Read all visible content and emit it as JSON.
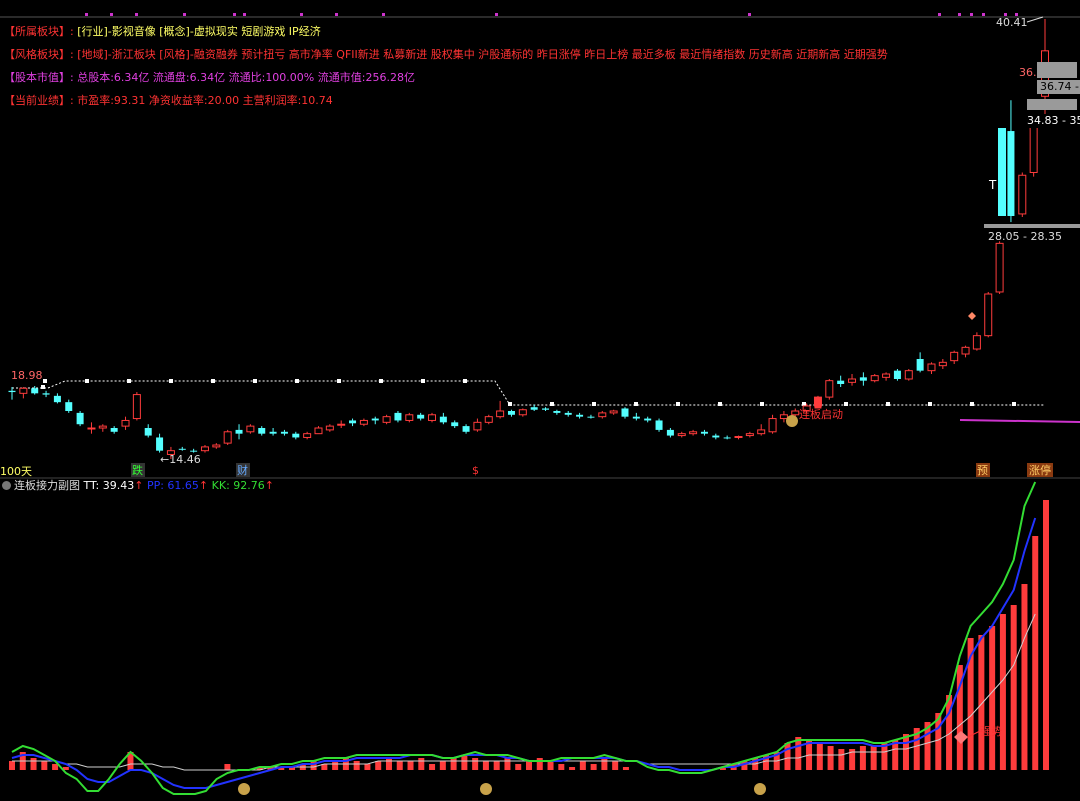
{
  "info_lines": [
    {
      "key": "【所属板块】:",
      "value": "[行业]-影视音像 [概念]-虚拟现实 短剧游戏 IP经济",
      "key_color": "#ff3333",
      "value_color": "#ffff66"
    },
    {
      "key": "【风格板块】:",
      "value": "[地域]-浙江板块 [风格]-融资融券 预计扭亏 高市净率 QFII新进 私募新进 股权集中 沪股通标的 昨日涨停 昨日上榜 最近多板 最近情绪指数 历史新高 近期新高 近期强势",
      "key_color": "#ff3333",
      "value_color": "#ff3333"
    },
    {
      "key": "【股本市值】:",
      "value": "总股本:6.34亿 流通盘:6.34亿 流通比:100.00% 流通市值:256.28亿",
      "key_color": "#e040e0",
      "value_color": "#e040e0"
    },
    {
      "key": "【当前业绩】:",
      "value": "市盈率:93.31 净资收益率:20.00 主营利润率:10.74",
      "key_color": "#ff3333",
      "value_color": "#ff3333"
    }
  ],
  "price_labels": {
    "low_left": "18.98",
    "low_mid": "←14.46",
    "high_right": "40.41",
    "level_36": "36.",
    "zone_1": "36.74 - 3",
    "zone_2": "34.83 - 35",
    "zone_3": "28.05 - 28.35",
    "t_marker": "T"
  },
  "markers": {
    "days100": "100天",
    "die": "跌",
    "cai": "财",
    "dollar": "$",
    "yu": "预",
    "zhangting": "涨停",
    "lianban": "连板启动",
    "qiangshi": "强势"
  },
  "sub_panel": {
    "name": "连板接力副图",
    "tt_label": "TT: 39.43",
    "pp_label": "PP: 61.65",
    "kk_label": "KK: 92.76",
    "arrow": "↑"
  },
  "colors": {
    "up": "#ff3c3c",
    "down": "#54ffff",
    "kk_line": "#33dd33",
    "pp_line": "#2233ff",
    "tt_line": "#d0d0d0",
    "ma_dotted": "#ffffff",
    "magenta": "#cc33cc"
  },
  "chart_data": {
    "type": "candlestick",
    "y_axis": "price",
    "candles": [
      {
        "o": 18.6,
        "h": 18.9,
        "l": 17.9,
        "c": 18.5
      },
      {
        "o": 18.4,
        "h": 18.9,
        "l": 18.0,
        "c": 18.8
      },
      {
        "o": 18.8,
        "h": 18.98,
        "l": 18.3,
        "c": 18.4
      },
      {
        "o": 18.4,
        "h": 18.6,
        "l": 18.1,
        "c": 18.3
      },
      {
        "o": 18.2,
        "h": 18.4,
        "l": 17.6,
        "c": 17.7
      },
      {
        "o": 17.7,
        "h": 17.9,
        "l": 16.9,
        "c": 17.0
      },
      {
        "o": 16.9,
        "h": 17.0,
        "l": 16.2,
        "c": 16.3
      },
      {
        "o": 16.1,
        "h": 16.4,
        "l": 15.8,
        "c": 16.1
      },
      {
        "o": 16.1,
        "h": 16.3,
        "l": 15.9,
        "c": 16.2
      },
      {
        "o": 16.1,
        "h": 16.2,
        "l": 15.8,
        "c": 15.9
      },
      {
        "o": 16.2,
        "h": 16.7,
        "l": 16.0,
        "c": 16.5
      },
      {
        "o": 16.6,
        "h": 18.5,
        "l": 16.5,
        "c": 18.3
      },
      {
        "o": 16.1,
        "h": 16.3,
        "l": 15.6,
        "c": 15.7
      },
      {
        "o": 15.6,
        "h": 15.8,
        "l": 14.8,
        "c": 14.9
      },
      {
        "o": 14.7,
        "h": 15.1,
        "l": 14.46,
        "c": 14.9
      },
      {
        "o": 15.0,
        "h": 15.1,
        "l": 14.9,
        "c": 14.95
      },
      {
        "o": 14.9,
        "h": 15.0,
        "l": 14.8,
        "c": 14.85
      },
      {
        "o": 14.9,
        "h": 15.2,
        "l": 14.8,
        "c": 15.1
      },
      {
        "o": 15.1,
        "h": 15.3,
        "l": 15.0,
        "c": 15.2
      },
      {
        "o": 15.3,
        "h": 16.0,
        "l": 15.2,
        "c": 15.9
      },
      {
        "o": 16.0,
        "h": 16.3,
        "l": 15.5,
        "c": 15.8
      },
      {
        "o": 15.9,
        "h": 16.3,
        "l": 15.8,
        "c": 16.2
      },
      {
        "o": 16.1,
        "h": 16.2,
        "l": 15.7,
        "c": 15.8
      },
      {
        "o": 15.9,
        "h": 16.1,
        "l": 15.7,
        "c": 15.8
      },
      {
        "o": 15.9,
        "h": 16.0,
        "l": 15.7,
        "c": 15.8
      },
      {
        "o": 15.8,
        "h": 15.9,
        "l": 15.5,
        "c": 15.6
      },
      {
        "o": 15.6,
        "h": 15.9,
        "l": 15.5,
        "c": 15.8
      },
      {
        "o": 15.8,
        "h": 16.2,
        "l": 15.8,
        "c": 16.1
      },
      {
        "o": 16.0,
        "h": 16.3,
        "l": 15.9,
        "c": 16.2
      },
      {
        "o": 16.3,
        "h": 16.5,
        "l": 16.1,
        "c": 16.3
      },
      {
        "o": 16.5,
        "h": 16.6,
        "l": 16.2,
        "c": 16.35
      },
      {
        "o": 16.3,
        "h": 16.6,
        "l": 16.2,
        "c": 16.5
      },
      {
        "o": 16.6,
        "h": 16.7,
        "l": 16.3,
        "c": 16.5
      },
      {
        "o": 16.4,
        "h": 16.8,
        "l": 16.3,
        "c": 16.7
      },
      {
        "o": 16.9,
        "h": 17.0,
        "l": 16.4,
        "c": 16.5
      },
      {
        "o": 16.5,
        "h": 16.9,
        "l": 16.4,
        "c": 16.8
      },
      {
        "o": 16.8,
        "h": 16.9,
        "l": 16.5,
        "c": 16.6
      },
      {
        "o": 16.5,
        "h": 16.9,
        "l": 16.4,
        "c": 16.8
      },
      {
        "o": 16.7,
        "h": 16.9,
        "l": 16.3,
        "c": 16.4
      },
      {
        "o": 16.4,
        "h": 16.5,
        "l": 16.1,
        "c": 16.2
      },
      {
        "o": 16.2,
        "h": 16.3,
        "l": 15.8,
        "c": 15.9
      },
      {
        "o": 16.0,
        "h": 16.6,
        "l": 15.9,
        "c": 16.4
      },
      {
        "o": 16.4,
        "h": 16.8,
        "l": 16.3,
        "c": 16.7
      },
      {
        "o": 16.7,
        "h": 17.8,
        "l": 16.6,
        "c": 17.0
      },
      {
        "o": 17.0,
        "h": 17.1,
        "l": 16.7,
        "c": 16.8
      },
      {
        "o": 16.8,
        "h": 17.2,
        "l": 16.7,
        "c": 17.1
      },
      {
        "o": 17.3,
        "h": 17.5,
        "l": 17.0,
        "c": 17.1
      },
      {
        "o": 17.2,
        "h": 17.3,
        "l": 17.0,
        "c": 17.1
      },
      {
        "o": 17.0,
        "h": 17.1,
        "l": 16.8,
        "c": 16.9
      },
      {
        "o": 16.9,
        "h": 17.0,
        "l": 16.7,
        "c": 16.8
      },
      {
        "o": 16.8,
        "h": 16.9,
        "l": 16.6,
        "c": 16.7
      },
      {
        "o": 16.7,
        "h": 16.8,
        "l": 16.6,
        "c": 16.65
      },
      {
        "o": 16.7,
        "h": 17.0,
        "l": 16.6,
        "c": 16.9
      },
      {
        "o": 16.9,
        "h": 17.1,
        "l": 16.8,
        "c": 17.0
      },
      {
        "o": 17.2,
        "h": 17.3,
        "l": 16.6,
        "c": 16.7
      },
      {
        "o": 16.7,
        "h": 16.9,
        "l": 16.5,
        "c": 16.6
      },
      {
        "o": 16.6,
        "h": 16.7,
        "l": 16.4,
        "c": 16.5
      },
      {
        "o": 16.5,
        "h": 16.6,
        "l": 15.9,
        "c": 16.0
      },
      {
        "o": 16.0,
        "h": 16.1,
        "l": 15.6,
        "c": 15.7
      },
      {
        "o": 15.7,
        "h": 15.9,
        "l": 15.6,
        "c": 15.8
      },
      {
        "o": 15.8,
        "h": 16.0,
        "l": 15.7,
        "c": 15.9
      },
      {
        "o": 15.9,
        "h": 16.0,
        "l": 15.7,
        "c": 15.8
      },
      {
        "o": 15.7,
        "h": 15.8,
        "l": 15.5,
        "c": 15.6
      },
      {
        "o": 15.6,
        "h": 15.7,
        "l": 15.5,
        "c": 15.55
      },
      {
        "o": 15.6,
        "h": 15.7,
        "l": 15.5,
        "c": 15.65
      },
      {
        "o": 15.7,
        "h": 15.9,
        "l": 15.6,
        "c": 15.8
      },
      {
        "o": 15.8,
        "h": 16.3,
        "l": 15.7,
        "c": 16.0
      },
      {
        "o": 15.9,
        "h": 16.8,
        "l": 15.8,
        "c": 16.6
      },
      {
        "o": 16.6,
        "h": 17.0,
        "l": 16.4,
        "c": 16.8
      },
      {
        "o": 16.8,
        "h": 17.2,
        "l": 16.7,
        "c": 17.0
      },
      {
        "o": 17.0,
        "h": 17.6,
        "l": 16.9,
        "c": 17.4
      },
      {
        "o": 17.4,
        "h": 18.2,
        "l": 17.3,
        "c": 18.1
      },
      {
        "o": 18.1,
        "h": 19.4,
        "l": 17.9,
        "c": 19.3
      },
      {
        "o": 19.3,
        "h": 19.6,
        "l": 18.9,
        "c": 19.1
      },
      {
        "o": 19.2,
        "h": 19.7,
        "l": 19.0,
        "c": 19.4
      },
      {
        "o": 19.5,
        "h": 19.8,
        "l": 19.0,
        "c": 19.3
      },
      {
        "o": 19.3,
        "h": 19.7,
        "l": 19.2,
        "c": 19.6
      },
      {
        "o": 19.5,
        "h": 19.8,
        "l": 19.3,
        "c": 19.7
      },
      {
        "o": 19.9,
        "h": 20.0,
        "l": 19.3,
        "c": 19.4
      },
      {
        "o": 19.4,
        "h": 20.0,
        "l": 19.3,
        "c": 19.9
      },
      {
        "o": 20.6,
        "h": 21.0,
        "l": 19.8,
        "c": 19.9
      },
      {
        "o": 19.9,
        "h": 20.4,
        "l": 19.7,
        "c": 20.3
      },
      {
        "o": 20.2,
        "h": 20.6,
        "l": 20.0,
        "c": 20.4
      },
      {
        "o": 20.5,
        "h": 21.1,
        "l": 20.3,
        "c": 21.0
      },
      {
        "o": 20.9,
        "h": 21.4,
        "l": 20.7,
        "c": 21.3
      },
      {
        "o": 21.2,
        "h": 22.2,
        "l": 21.1,
        "c": 22.0
      },
      {
        "o": 22.0,
        "h": 24.6,
        "l": 21.9,
        "c": 24.5
      },
      {
        "o": 24.6,
        "h": 27.1,
        "l": 24.5,
        "c": 27.0
      },
      {
        "o": 34.5,
        "h": 36.3,
        "l": 28.05,
        "c": 28.35
      },
      {
        "o": 28.5,
        "h": 31.5,
        "l": 28.3,
        "c": 31.3
      },
      {
        "o": 31.5,
        "h": 35.5,
        "l": 31.2,
        "c": 35.3
      },
      {
        "o": 36.5,
        "h": 40.41,
        "l": 35.0,
        "c": 38.8
      }
    ],
    "ma_dotted_levels": [
      18.9,
      19.2,
      17.0,
      17.0
    ],
    "sub_series": {
      "bars": [
        3,
        6,
        4,
        3,
        2,
        1,
        0,
        0,
        0,
        0,
        0,
        6,
        0,
        0,
        0,
        0,
        0,
        0,
        0,
        0,
        2,
        0,
        0,
        1,
        1,
        1,
        1,
        2,
        3,
        2,
        3,
        4,
        3,
        2,
        3,
        4,
        3,
        3,
        4,
        2,
        3,
        4,
        5,
        4,
        3,
        3,
        4,
        2,
        3,
        4,
        3,
        2,
        1,
        3,
        2,
        4,
        3,
        1,
        0,
        0,
        0,
        0,
        0,
        0,
        0,
        0,
        1,
        2,
        3,
        4,
        5,
        6,
        9,
        11,
        10,
        9,
        8,
        7,
        7,
        8,
        8,
        9,
        10,
        12,
        14,
        16,
        19,
        25,
        35,
        44,
        45,
        48,
        52,
        55,
        62,
        78,
        90
      ],
      "kk": [
        6,
        8,
        7,
        5,
        3,
        -1,
        -3,
        -7,
        -7,
        -3,
        2,
        6,
        3,
        -1,
        -6,
        -8,
        -8,
        -8,
        -7,
        -3,
        -1,
        0,
        0,
        1,
        1,
        2,
        2,
        3,
        3,
        4,
        4,
        4,
        5,
        5,
        5,
        5,
        5,
        5,
        5,
        5,
        4,
        4,
        5,
        6,
        5,
        5,
        5,
        4,
        3,
        3,
        3,
        4,
        4,
        4,
        4,
        5,
        4,
        3,
        3,
        1,
        0,
        0,
        -1,
        -1,
        -1,
        0,
        1,
        2,
        3,
        4,
        5,
        6,
        9,
        10,
        10,
        10,
        10,
        10,
        10,
        10,
        9,
        9,
        10,
        11,
        12,
        14,
        17,
        24,
        38,
        48,
        52,
        56,
        62,
        70,
        88,
        96
      ],
      "pp": [
        4,
        5,
        5,
        4,
        3,
        2,
        0,
        -3,
        -4,
        -4,
        -2,
        0,
        0,
        -1,
        -3,
        -5,
        -6,
        -6,
        -6,
        -5,
        -4,
        -3,
        -2,
        -1,
        0,
        1,
        1,
        2,
        2,
        3,
        3,
        3,
        4,
        4,
        4,
        4,
        4,
        5,
        5,
        5,
        4,
        4,
        5,
        5,
        5,
        5,
        4,
        4,
        3,
        3,
        3,
        3,
        4,
        4,
        4,
        4,
        4,
        3,
        3,
        2,
        1,
        1,
        0,
        0,
        0,
        0,
        1,
        1,
        2,
        3,
        4,
        5,
        7,
        8,
        9,
        9,
        9,
        9,
        9,
        9,
        8,
        8,
        9,
        9,
        10,
        12,
        14,
        19,
        28,
        38,
        44,
        48,
        54,
        60,
        73,
        84
      ],
      "tt": [
        3,
        3,
        3,
        3,
        3,
        2,
        2,
        1,
        1,
        1,
        1,
        2,
        2,
        2,
        1,
        1,
        0,
        0,
        0,
        0,
        0,
        0,
        0,
        0,
        1,
        1,
        1,
        1,
        1,
        2,
        2,
        2,
        2,
        2,
        3,
        3,
        3,
        3,
        3,
        3,
        3,
        3,
        3,
        3,
        3,
        3,
        3,
        3,
        3,
        3,
        3,
        3,
        3,
        3,
        3,
        3,
        3,
        3,
        3,
        2,
        2,
        2,
        2,
        2,
        2,
        2,
        2,
        2,
        2,
        2,
        3,
        3,
        4,
        4,
        5,
        5,
        5,
        5,
        6,
        6,
        6,
        6,
        7,
        7,
        8,
        9,
        10,
        12,
        15,
        18,
        22,
        26,
        30,
        35,
        44,
        52
      ]
    }
  }
}
